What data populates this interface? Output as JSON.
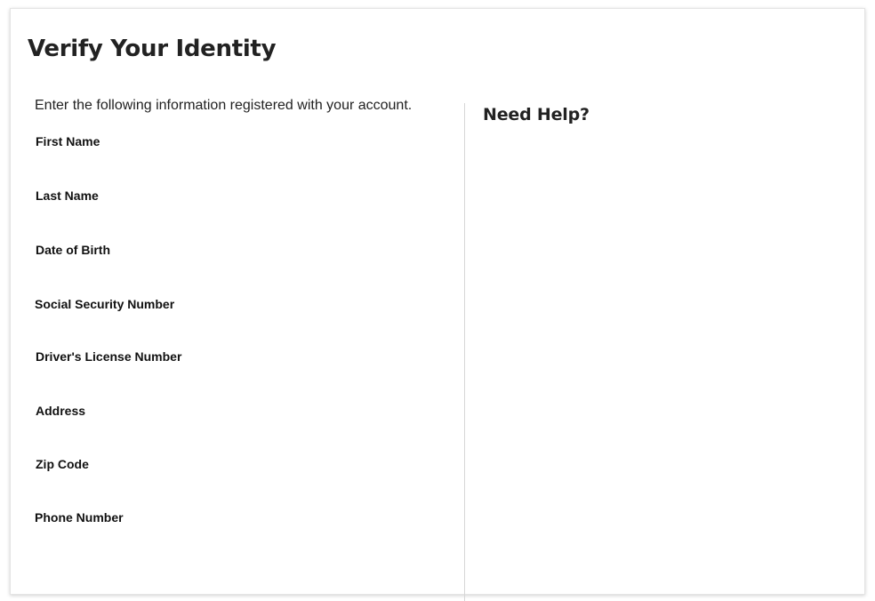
{
  "form": {
    "title": "Verify Your Identity",
    "intro": "Enter the following information registered with your account.",
    "fields": [
      {
        "label": "First Name"
      },
      {
        "label": "Last Name"
      },
      {
        "label": "Date of Birth"
      },
      {
        "label": "Social Security Number"
      },
      {
        "label": "Driver's License Number"
      },
      {
        "label": "Address"
      },
      {
        "label": "Zip Code"
      },
      {
        "label": "Phone Number"
      }
    ]
  },
  "help": {
    "title": "Need Help?"
  }
}
